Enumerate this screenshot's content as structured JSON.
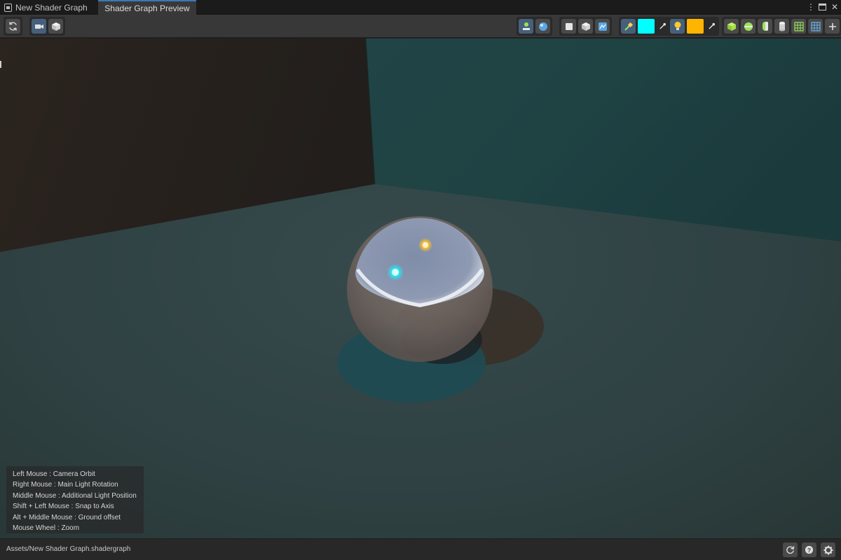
{
  "tabs": [
    {
      "label": "New Shader Graph",
      "active": false
    },
    {
      "label": "Shader Graph Preview",
      "active": true
    }
  ],
  "window_controls": {
    "menu": "⋮",
    "close": "✕"
  },
  "toolbar": {
    "left_group_1": [
      "refresh-icon"
    ],
    "left_group_2": [
      "camera-icon",
      "cube-icon"
    ],
    "right_group_1": [
      "lit-mode-icon",
      "sphere-icon"
    ],
    "right_group_2": [
      "square-icon",
      "cube-icon",
      "skybox-icon"
    ],
    "right_group_3": [
      "main-light-icon",
      "main-light-color",
      "eyedropper-icon",
      "additional-light-icon",
      "additional-light-color",
      "eyedropper-icon"
    ],
    "right_group_4": [
      "cube-mesh-icon",
      "sphere-mesh-icon",
      "capsule-mesh-icon",
      "cylinder-mesh-icon",
      "grid-icon",
      "grid-blue-icon",
      "plus-icon"
    ]
  },
  "colors": {
    "accent": "#3a79bb",
    "main_light_color": "#00ffff",
    "additional_light_color": "#ffb400"
  },
  "hints": [
    "Left Mouse : Camera Orbit",
    "Right Mouse : Main Light Rotation",
    "Middle Mouse : Additional Light Position",
    "Shift + Left Mouse : Snap to Axis",
    "Alt + Middle Mouse : Ground offset",
    "Mouse Wheel : Zoom"
  ],
  "status": {
    "asset_path": "Assets/New Shader Graph.shadergraph"
  }
}
